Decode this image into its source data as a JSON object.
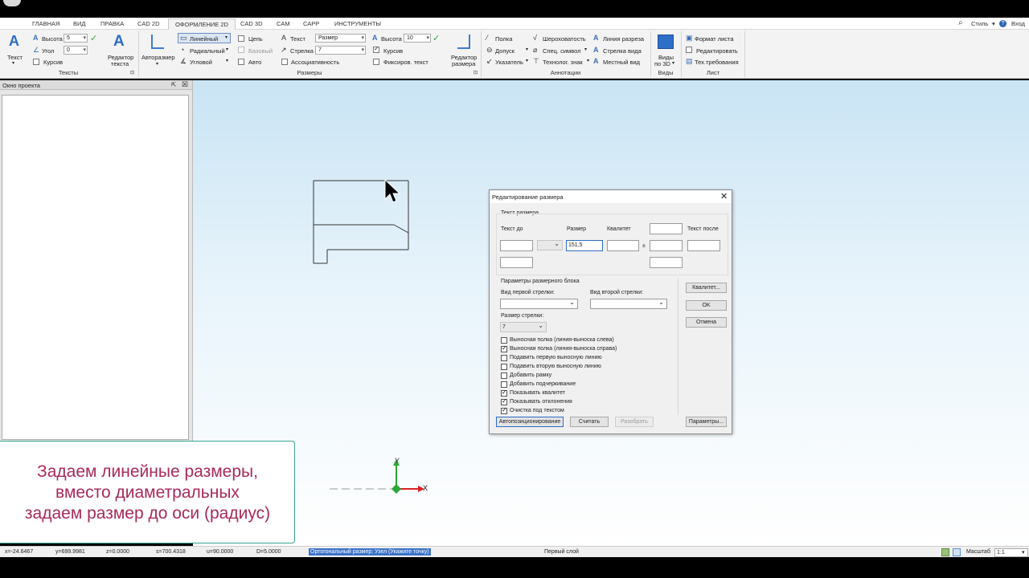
{
  "topbar": {
    "style_label": "Стиль",
    "login_label": "Вход"
  },
  "menu": {
    "tabs": [
      "ГЛАВНАЯ",
      "ВИД",
      "ПРАВКА",
      "CAD 2D",
      "ОФОРМЛЕНИЕ 2D",
      "CAD 3D",
      "CAM",
      "САРР",
      "ИНСТРУМЕНТЫ"
    ],
    "active": "ОФОРМЛЕНИЕ 2D"
  },
  "ribbon": {
    "texts": {
      "text_btn": "Текст",
      "height_label": "Высота",
      "height_value": "5",
      "angle_label": "Угол",
      "angle_value": "0",
      "italic_label": "Курсив",
      "editor_line1": "Редактор",
      "editor_line2": "текста",
      "group": "Тексты"
    },
    "dims": {
      "auto_label": "Авторазмер",
      "linear": "Линейный",
      "radial": "Радиальный",
      "angular": "Угловой",
      "chain": "Цепь",
      "base": "Базовый",
      "auto": "Авто",
      "text_label": "Текст",
      "text_value": "Размер",
      "arrow_label": "Стрелка",
      "arrow_value": "7",
      "assoc": "Ассоциативность",
      "height_label": "Высота",
      "height_value": "10",
      "italic": "Курсив",
      "fixed_text": "Фиксиров. текст",
      "editor_line1": "Редактор",
      "editor_line2": "размера",
      "group": "Размеры"
    },
    "annot": {
      "shelf": "Полка",
      "tolerance": "Допуск",
      "pointer": "Указатель",
      "roughness": "Шероховатость",
      "spec_symbol": "Спец. символ",
      "tech_mark": "Технолог. знак",
      "section_line": "Линия разреза",
      "view_arrow": "Стрелка вида",
      "local_view": "Местный вид",
      "group": "Аннотации"
    },
    "views": {
      "line1": "Виды",
      "line2": "по 3D",
      "group": "Виды"
    },
    "sheet": {
      "format": "Формат листа",
      "edit": "Редактировать",
      "tech": "Тех.требования",
      "group": "Лист"
    }
  },
  "project_panel": {
    "title": "Окно проекта"
  },
  "canvas": {
    "axis_x": "X",
    "axis_y": "Y"
  },
  "dialog": {
    "title": "Редактирование размера",
    "section_text": "Текст размера",
    "col_before": "Текст до",
    "col_size": "Размер",
    "col_quality": "Квалитет",
    "col_after": "Текст после",
    "size_value": "151,5",
    "pm_sign": "±",
    "section_block": "Параметры размерного блока",
    "first_arrow": "Вид первой стрелки:",
    "second_arrow": "Вид второй стрелки:",
    "arrow_size": "Размер стрелки:",
    "arrow_size_value": "7",
    "checks": [
      {
        "label": "Выносная полка (линия-выноска слева)",
        "checked": false
      },
      {
        "label": "Выносная полка (линия-выноска справа)",
        "checked": true
      },
      {
        "label": "Подавить первую выносную линию",
        "checked": false
      },
      {
        "label": "Подавить вторую выносную линию",
        "checked": false
      },
      {
        "label": "Добавить рамку",
        "checked": false
      },
      {
        "label": "Добавить подчеркивание",
        "checked": false
      },
      {
        "label": "Показывать квалитет",
        "checked": true
      },
      {
        "label": "Показывать отклонения",
        "checked": true
      },
      {
        "label": "Очистка под текстом",
        "checked": true
      }
    ],
    "btn_quality": "Квалитет...",
    "btn_ok": "OK",
    "btn_cancel": "Отмена",
    "btn_autopos": "Автопозиционирование",
    "btn_read": "Считать",
    "btn_explode": "Разобрать",
    "btn_params": "Параметры..."
  },
  "caption": {
    "line1": "Задаем линейные размеры,",
    "line2": "вместо диаметральных",
    "line3": "задаем размер до оси (радиус)"
  },
  "status": {
    "x": "x=-24.6467",
    "y": "y=699.9981",
    "z": "z=0.0000",
    "s": "s=700.4318",
    "u": "u=90.0000",
    "d": "D=5.0000",
    "prompt": "Ортогональный размер: Узел (Укажите точку)",
    "layer": "Первый слой",
    "scale_label": "Масштаб",
    "scale_value": "1:1"
  }
}
